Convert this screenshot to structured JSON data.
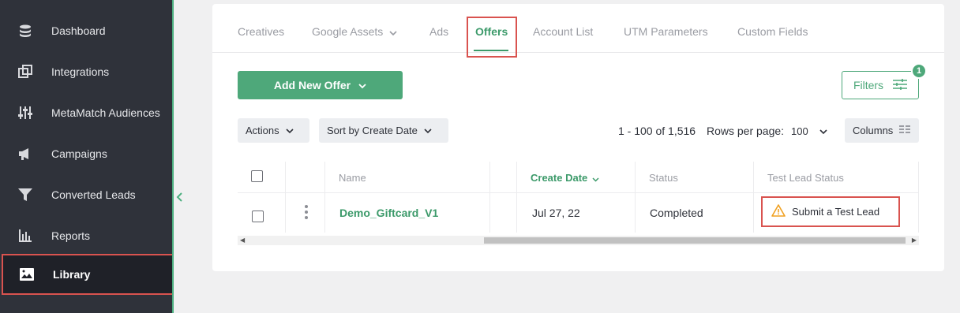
{
  "sidebar": {
    "items": [
      {
        "label": "Dashboard",
        "icon": "database-icon"
      },
      {
        "label": "Integrations",
        "icon": "integrations-icon"
      },
      {
        "label": "MetaMatch Audiences",
        "icon": "sliders-icon"
      },
      {
        "label": "Campaigns",
        "icon": "megaphone-icon"
      },
      {
        "label": "Converted Leads",
        "icon": "funnel-icon"
      },
      {
        "label": "Reports",
        "icon": "bar-chart-icon"
      },
      {
        "label": "Library",
        "icon": "image-icon",
        "active": true
      }
    ]
  },
  "tabs": [
    {
      "label": "Creatives"
    },
    {
      "label": "Google Assets"
    },
    {
      "label": "Ads"
    },
    {
      "label": "Offers",
      "active": true
    },
    {
      "label": "Account List"
    },
    {
      "label": "UTM Parameters"
    },
    {
      "label": "Custom Fields"
    }
  ],
  "toolbar": {
    "add_label": "Add New Offer",
    "filters_label": "Filters",
    "filters_count": "1",
    "actions_label": "Actions",
    "sort_label": "Sort by Create Date",
    "pager_text": "1 - 100 of 1,516",
    "rows_label": "Rows per page:",
    "rows_value": "100",
    "columns_label": "Columns"
  },
  "table": {
    "columns": [
      "Name",
      "Create Date",
      "Status",
      "Test Lead Status"
    ],
    "rows": [
      {
        "name": "Demo_Giftcard_V1",
        "create_date": "Jul 27, 22",
        "status": "Completed",
        "test_lead_status": "Submit a Test Lead"
      }
    ]
  },
  "colors": {
    "accent": "#4ea87a",
    "highlight": "#d9534f",
    "sidebar_bg": "#2f323a"
  }
}
